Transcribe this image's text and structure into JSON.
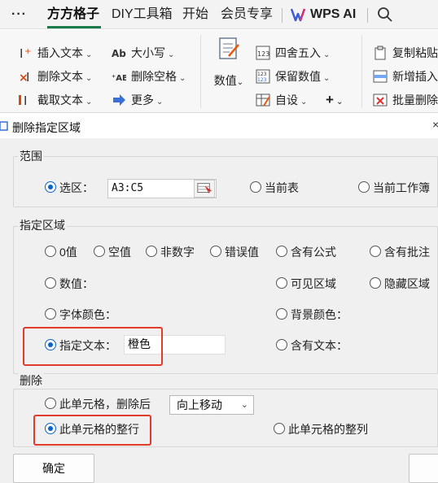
{
  "menu": {
    "more": "···",
    "tabs": [
      "方方格子",
      "DIY工具箱",
      "开始",
      "会员专享",
      "WPS AI"
    ]
  },
  "ribbon": {
    "col1": [
      "插入文本",
      "删除文本",
      "截取文本"
    ],
    "col2": [
      "大小写",
      "删除空格",
      "更多"
    ],
    "big": "数值",
    "col3": [
      "四舍五入",
      "保留数值",
      "自设"
    ],
    "plus": "+",
    "col4": [
      "复制粘贴",
      "新增插入",
      "批量删除"
    ]
  },
  "dialog": {
    "title": "删除指定区域",
    "close": "×",
    "range": {
      "label": "范围",
      "selection_label": "选区：",
      "selection_value": "A3:C5",
      "current_sheet": "当前表",
      "current_workbook": "当前工作簿"
    },
    "specified": {
      "label": "指定区域",
      "zero": "0值",
      "empty": "空值",
      "non_numeric": "非数字",
      "error": "错误值",
      "has_formula": "含有公式",
      "has_comment": "含有批注",
      "numeric": "数值：",
      "visible": "可见区域",
      "hidden": "隐藏区域",
      "font_color": "字体颜色：",
      "bg_color": "背景颜色：",
      "specific_text": "指定文本：",
      "specific_text_value": "橙色",
      "contains_text": "含有文本："
    },
    "delete": {
      "label": "删除",
      "cell_label": "此单元格，删除后",
      "shift_option": "向上移动",
      "entire_row": "此单元格的整行",
      "entire_col": "此单元格的整列"
    },
    "ok": "确定"
  }
}
